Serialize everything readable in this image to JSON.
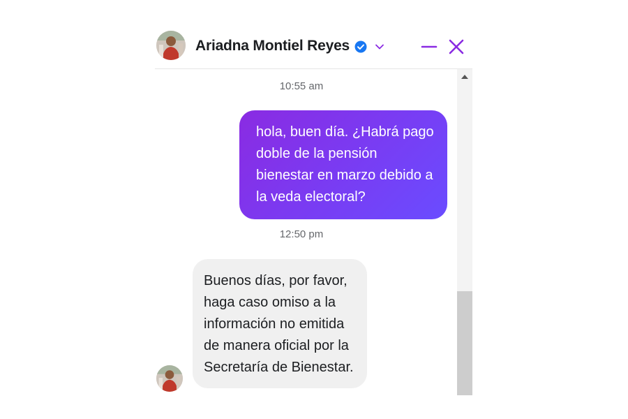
{
  "header": {
    "contact_name": "Ariadna Montiel Reyes",
    "verified_icon": "verified-badge-icon",
    "chevron_icon": "chevron-down-icon",
    "minimize_icon": "minimize-icon",
    "close_icon": "close-icon"
  },
  "messages": [
    {
      "type": "timestamp",
      "text": "10:55 am"
    },
    {
      "type": "outgoing",
      "text": "hola, buen día. ¿Habrá pago doble de la pensión bienestar en marzo debido a la veda electoral?"
    },
    {
      "type": "timestamp",
      "text": "12:50 pm"
    },
    {
      "type": "incoming",
      "text": "Buenos días, por favor, haga caso omiso a la información no emitida de manera oficial por la Secretaría de Bienestar."
    }
  ],
  "colors": {
    "accent": "#8a2be2",
    "outgoing_bubble_start": "#8a2be2",
    "outgoing_bubble_end": "#6a4cff",
    "incoming_bubble": "#f0f0f0",
    "verified": "#1877f2"
  }
}
